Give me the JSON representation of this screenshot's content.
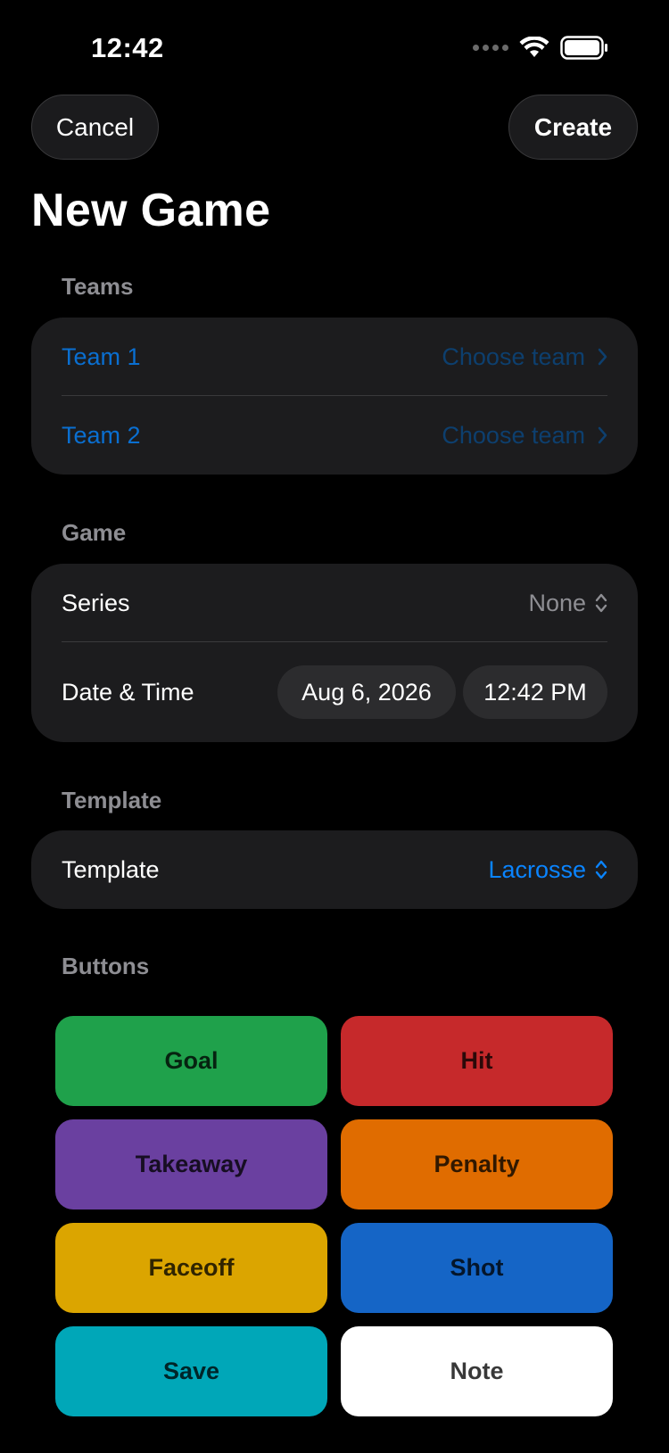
{
  "status_bar": {
    "time": "12:42"
  },
  "nav": {
    "cancel_label": "Cancel",
    "create_label": "Create"
  },
  "page_title": "New Game",
  "teams_section": {
    "header": "Teams",
    "rows": [
      {
        "label": "Team 1",
        "value": "Choose team"
      },
      {
        "label": "Team 2",
        "value": "Choose team"
      }
    ]
  },
  "game_section": {
    "header": "Game",
    "series_label": "Series",
    "series_value": "None",
    "datetime_label": "Date & Time",
    "date_value": "Aug 6, 2026",
    "time_value": "12:42 PM"
  },
  "template_section": {
    "header": "Template",
    "label": "Template",
    "value": "Lacrosse"
  },
  "buttons_section": {
    "header": "Buttons",
    "items": [
      {
        "label": "Goal",
        "color": "#1fa14b"
      },
      {
        "label": "Hit",
        "color": "#c6292b"
      },
      {
        "label": "Takeaway",
        "color": "#6a40a0"
      },
      {
        "label": "Penalty",
        "color": "#e06c00"
      },
      {
        "label": "Faceoff",
        "color": "#dba500"
      },
      {
        "label": "Shot",
        "color": "#1565c6"
      },
      {
        "label": "Save",
        "color": "#00a7b8"
      },
      {
        "label": "Note",
        "color": "#ffffff"
      }
    ]
  },
  "icons": {
    "chevron": "chevron-right-icon",
    "updown": "chevron-up-down-icon",
    "wifi": "wifi-icon",
    "battery": "battery-icon",
    "signal": "cellular-signal-icon"
  }
}
